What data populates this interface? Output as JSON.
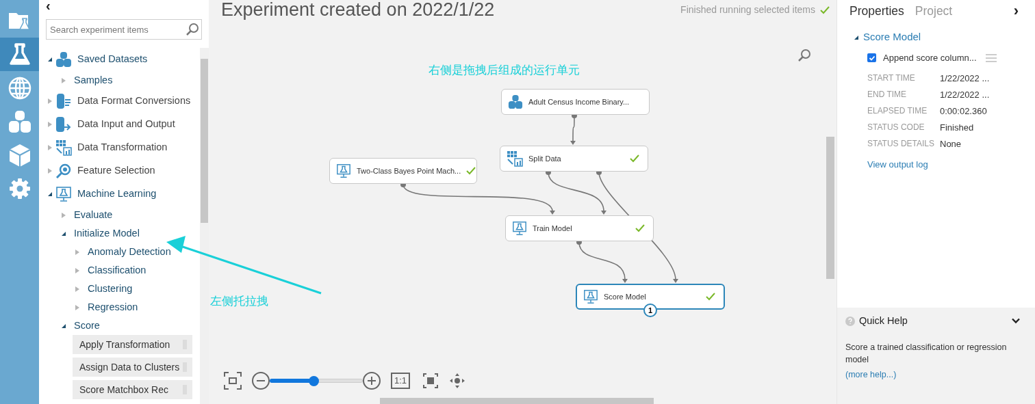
{
  "rail": [
    {
      "selected": false
    },
    {
      "selected": true
    },
    {
      "selected": false
    },
    {
      "selected": false
    },
    {
      "selected": false
    },
    {
      "selected": false
    }
  ],
  "palette": {
    "collapse": "‹",
    "search": {
      "placeholder": "Search experiment items"
    },
    "tree": [
      {
        "label": "Saved Datasets",
        "kind": "category",
        "expanded": true,
        "children": [
          {
            "label": "Samples",
            "kind": "folder",
            "expanded": false
          }
        ]
      },
      {
        "label": "Data Format Conversions",
        "kind": "category",
        "expanded": false
      },
      {
        "label": "Data Input and Output",
        "kind": "category",
        "expanded": false
      },
      {
        "label": "Data Transformation",
        "kind": "category",
        "expanded": false
      },
      {
        "label": "Feature Selection",
        "kind": "category",
        "expanded": false
      },
      {
        "label": "Machine Learning",
        "kind": "category",
        "expanded": true,
        "children": [
          {
            "label": "Evaluate",
            "kind": "folder",
            "expanded": false
          },
          {
            "label": "Initialize Model",
            "kind": "folder",
            "expanded": true,
            "children": [
              {
                "label": "Anomaly Detection",
                "kind": "folder",
                "expanded": false
              },
              {
                "label": "Classification",
                "kind": "folder",
                "expanded": false
              },
              {
                "label": "Clustering",
                "kind": "folder",
                "expanded": false
              },
              {
                "label": "Regression",
                "kind": "folder",
                "expanded": false
              }
            ]
          },
          {
            "label": "Score",
            "kind": "folder",
            "expanded": true,
            "children": [
              {
                "label": "Apply Transformation",
                "kind": "module"
              },
              {
                "label": "Assign Data to Clusters",
                "kind": "module"
              },
              {
                "label": "Score Matchbox Rec",
                "kind": "module"
              }
            ]
          }
        ]
      }
    ]
  },
  "canvas": {
    "title": "Experiment created on 2022/1/22",
    "status": "Finished running selected items",
    "nodes": [
      {
        "label": "Adult Census Income Binary...",
        "kind": "dataset",
        "finished": false,
        "selected": false
      },
      {
        "label": "Split Data",
        "kind": "transform",
        "finished": true,
        "selected": false
      },
      {
        "label": "Two-Class Bayes Point Mach...",
        "kind": "model",
        "finished": true,
        "selected": false
      },
      {
        "label": "Train Model",
        "kind": "model",
        "finished": true,
        "selected": false
      },
      {
        "label": "Score Model",
        "kind": "model",
        "finished": true,
        "selected": true,
        "badge": "1"
      }
    ],
    "zoom": {
      "level": 0.47,
      "actual_size": "1:1"
    }
  },
  "annotations": [
    {
      "text": "右侧是拖拽后组成的运行单元"
    },
    {
      "text": "左侧托拉拽"
    }
  ],
  "properties": {
    "tabs": [
      {
        "label": "Properties",
        "selected": true
      },
      {
        "label": "Project",
        "selected": false
      }
    ],
    "collapse": "›",
    "section": {
      "title": "Score Model",
      "expanded": true
    },
    "option": {
      "label": "Append score column...",
      "checked": true
    },
    "rows": [
      {
        "label": "START TIME",
        "value": "1/22/2022 ..."
      },
      {
        "label": "END TIME",
        "value": "1/22/2022 ..."
      },
      {
        "label": "ELAPSED TIME",
        "value": "0:00:02.360"
      },
      {
        "label": "STATUS CODE",
        "value": "Finished"
      },
      {
        "label": "STATUS DETAILS",
        "value": "None"
      }
    ],
    "link": "View output log"
  },
  "quick_help": {
    "title": "Quick Help",
    "expanded": true,
    "text": "Score a trained classification or regression model",
    "link": "(more help...)"
  }
}
